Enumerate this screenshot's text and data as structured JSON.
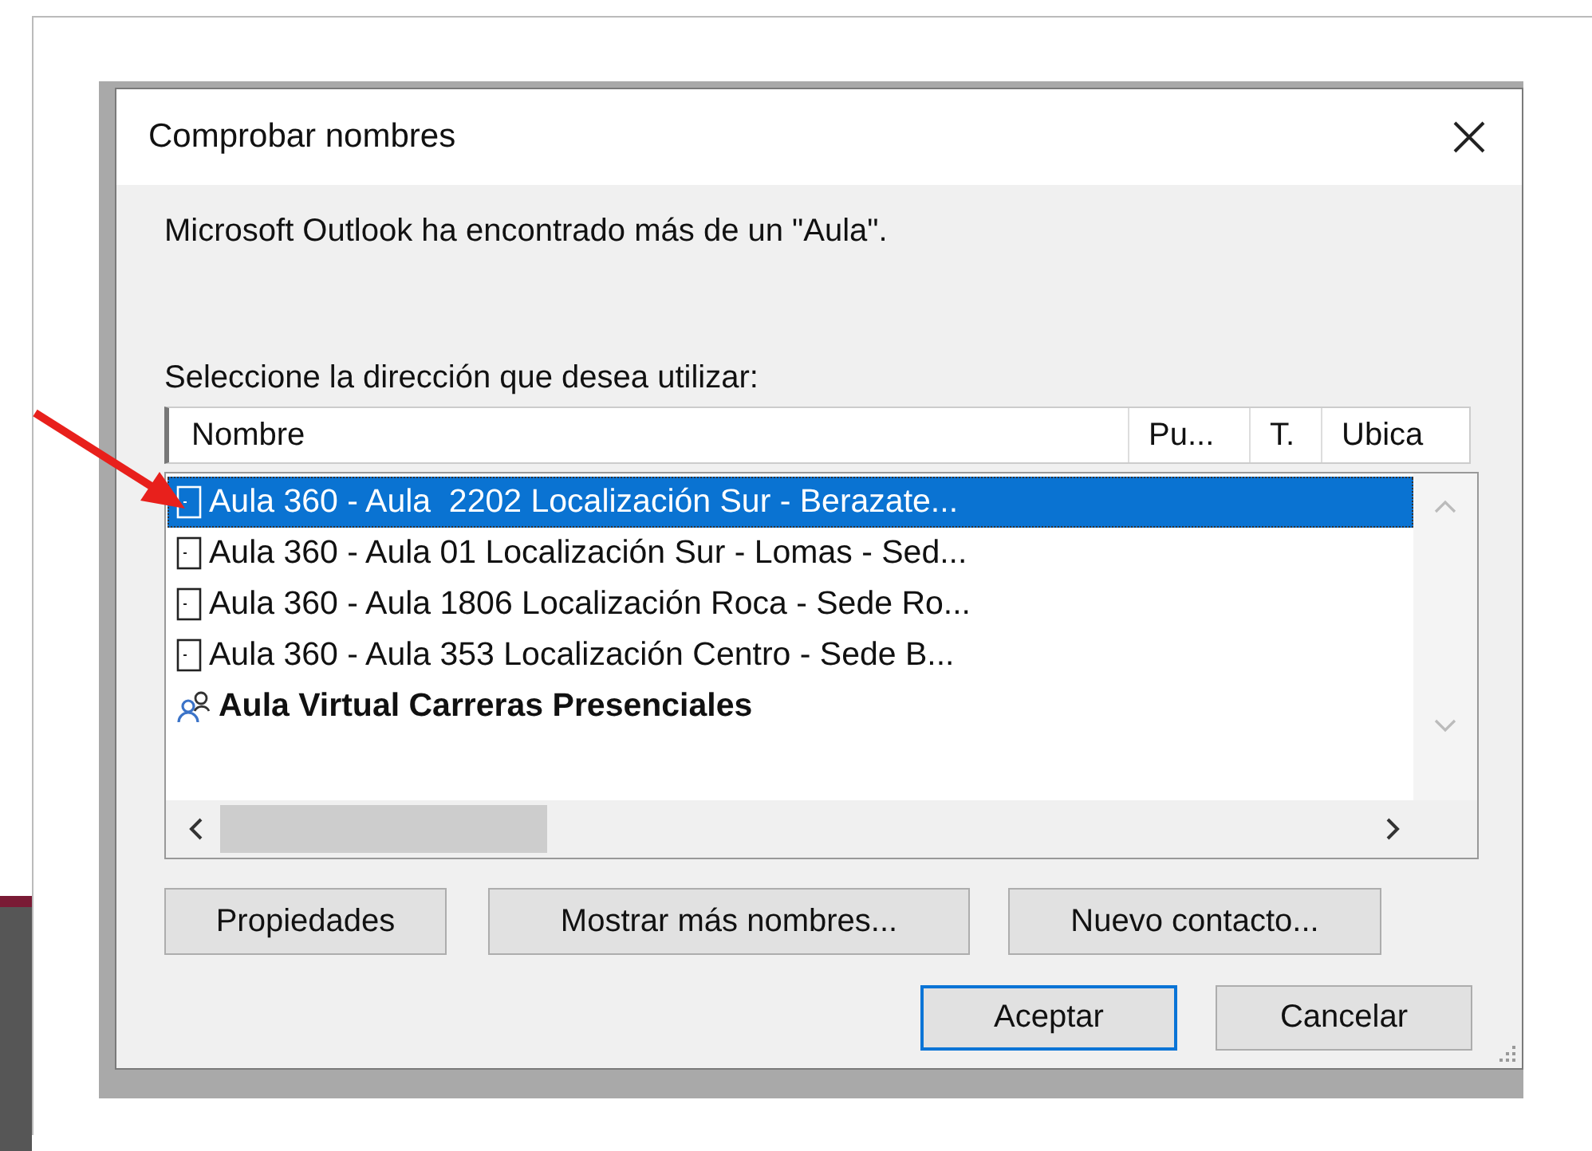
{
  "window": {
    "title": "Comprobar nombres"
  },
  "message": "Microsoft Outlook ha encontrado más de un \"Aula\".",
  "list_label": "Seleccione la dirección que desea utilizar:",
  "columns": [
    "Nombre",
    "Pu...",
    "T.",
    "Ubica"
  ],
  "rows": [
    {
      "kind": "room",
      "name": "Aula 360 - Aula  2202 Localización Sur - Berazate...",
      "selected": true
    },
    {
      "kind": "room",
      "name": "Aula 360 - Aula 01 Localización Sur - Lomas - Sed...",
      "selected": false
    },
    {
      "kind": "room",
      "name": "Aula 360 - Aula 1806 Localización Roca - Sede Ro...",
      "selected": false
    },
    {
      "kind": "room",
      "name": "Aula 360 - Aula 353 Localización Centro - Sede B...",
      "selected": false
    },
    {
      "kind": "group",
      "name": "Aula Virtual Carreras Presenciales",
      "selected": false
    }
  ],
  "action_buttons": [
    "Propiedades",
    "Mostrar más nombres...",
    "Nuevo contacto..."
  ],
  "dialog_buttons": [
    {
      "label": "Aceptar",
      "default": true
    },
    {
      "label": "Cancelar",
      "default": false
    }
  ]
}
